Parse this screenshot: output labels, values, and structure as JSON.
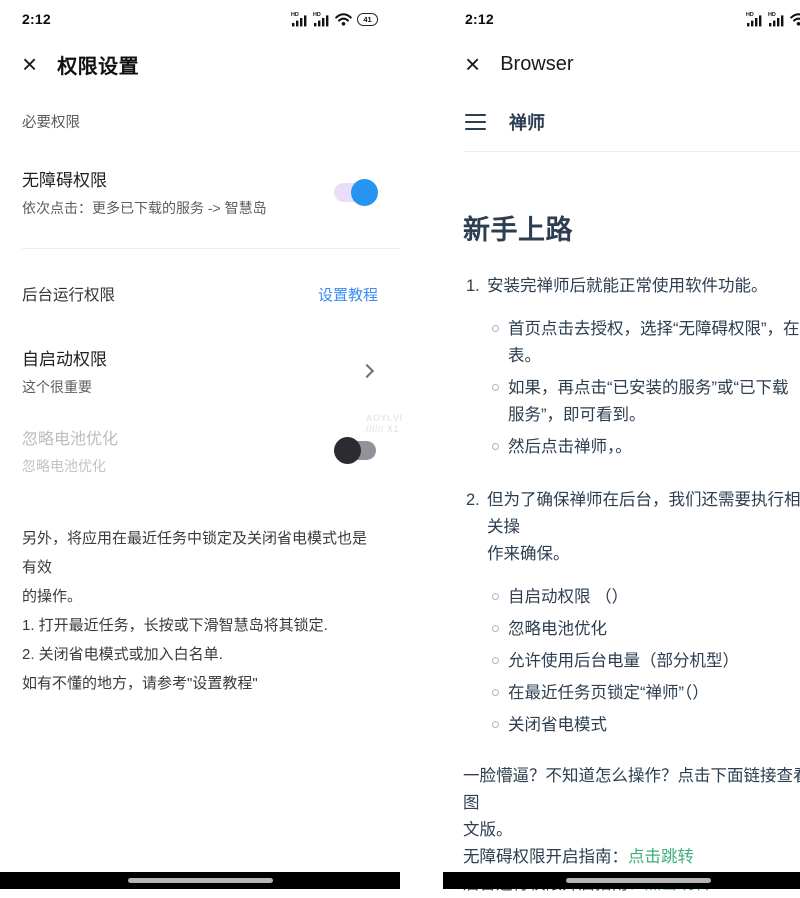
{
  "status": {
    "time": "2:12",
    "battery_percent": "41",
    "hd_label": "HD"
  },
  "left": {
    "header": {
      "close": "×",
      "title": "权限设置"
    },
    "section_label": "必要权限",
    "accessibility": {
      "title": "无障碍权限",
      "subtitle": "依次点击：更多已下载的服务 -> 智慧岛",
      "toggle_state": "on"
    },
    "background_run": {
      "title": "后台运行权限",
      "link": "设置教程"
    },
    "autostart": {
      "title": "自启动权限",
      "subtitle": "这个很重要"
    },
    "battery_opt": {
      "title": "忽略电池优化",
      "subtitle": "忽略电池优化",
      "toggle_state": "off"
    },
    "watermark": "AOYI.VI\n////// X1",
    "tips": "另外，将应用在最近任务中锁定及关闭省电模式也是有效\n的操作。\n1. 打开最近任务，长按或下滑智慧岛将其锁定.\n2. 关闭省电模式或加入白名单.\n如有不懂的地方，请参考\"设置教程\""
  },
  "right": {
    "header": {
      "close": "×",
      "title": "Browser"
    },
    "nav": {
      "title": "禅师"
    },
    "doc_title": "新手上路",
    "item1": {
      "num": "1.",
      "text": "安装完禅师后就能正常使用软件功能。"
    },
    "bullets1": [
      {
        "text": "首页点击去授权，选择“无障碍权限”，在列\n表。"
      },
      {
        "text": "如果，再点击“已安装的服务”或“已下载\n服务”，即可看到。"
      },
      {
        "text": "然后点击禅师，。"
      }
    ],
    "item2": {
      "num": "2.",
      "text": "但为了确保禅师在后台，我们还需要执行相关操\n作来确保。"
    },
    "bullets2": [
      {
        "text": "自启动权限 （）"
      },
      {
        "text": "忽略电池优化"
      },
      {
        "text": "允许使用后台电量（部分机型）"
      },
      {
        "text": "在最近任务页锁定“禅师”（）"
      },
      {
        "text": "关闭省电模式"
      }
    ],
    "outro": "一脸懵逼？不知道怎么操作？点击下面链接查看图\n文版。",
    "guide1": {
      "label": "无障碍权限开启指南：",
      "link": "点击跳转"
    },
    "guide2": {
      "label": "后台运行权限开启指南：",
      "link": "点击跳转"
    }
  },
  "colors": {
    "accent_blue": "#3b8cf5",
    "toggle_on_knob": "#2595f0",
    "toggle_on_track": "#e9ddf7",
    "toggle_off_knob": "#2b2b31",
    "toggle_off_track": "#92929b",
    "green_link": "#3eaf7c",
    "doc_text": "#2c3e50"
  }
}
